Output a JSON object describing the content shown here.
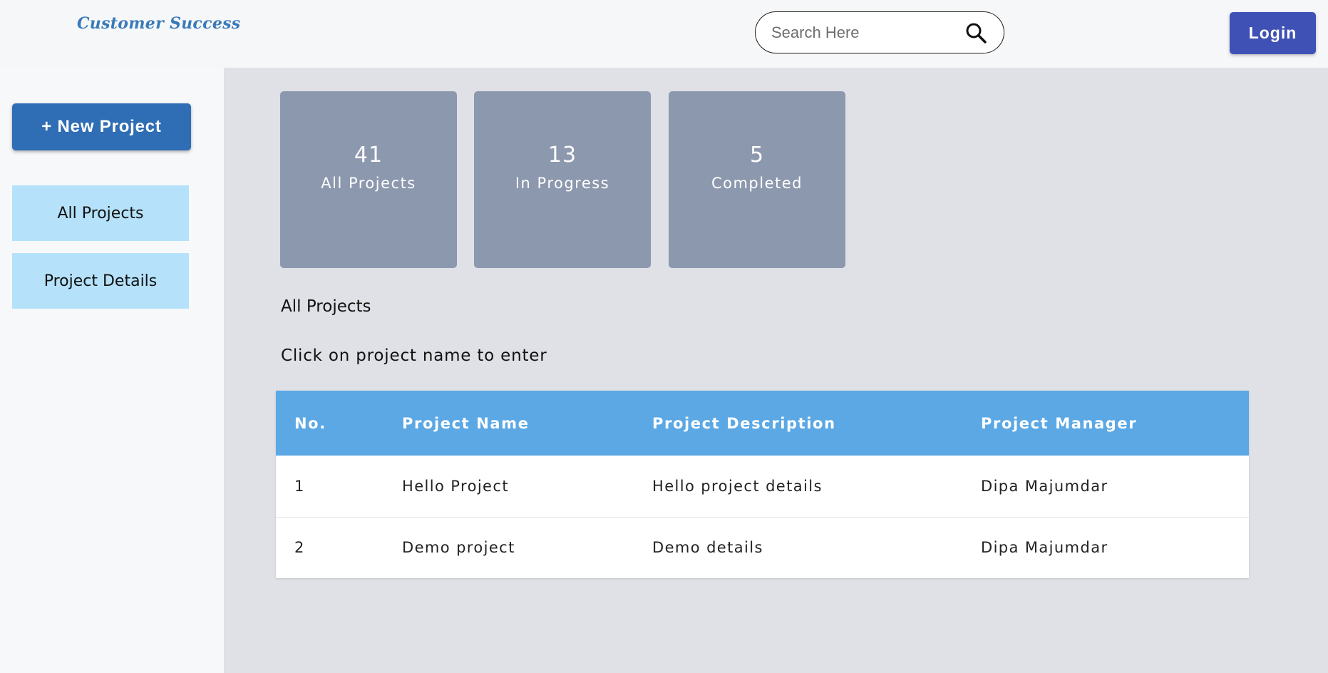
{
  "header": {
    "brand": "Customer Success",
    "search": {
      "placeholder": "Search Here",
      "value": ""
    },
    "login_label": "Login"
  },
  "sidebar": {
    "new_project_label": "+ New Project",
    "items": [
      {
        "label": "All Projects"
      },
      {
        "label": "Project Details"
      }
    ]
  },
  "stats": [
    {
      "value": "41",
      "label": "All Projects"
    },
    {
      "value": "13",
      "label": "In Progress"
    },
    {
      "value": "5",
      "label": "Completed"
    }
  ],
  "main": {
    "section_title": "All Projects",
    "hint": "Click on project name to enter"
  },
  "table": {
    "columns": [
      "No.",
      "Project Name",
      "Project Description",
      "Project Manager"
    ],
    "rows": [
      [
        "1",
        "Hello Project",
        "Hello project details",
        "Dipa Majumdar"
      ],
      [
        "2",
        "Demo project",
        "Demo details",
        "Dipa Majumdar"
      ]
    ]
  },
  "colors": {
    "brand": "#3a7ab8",
    "login_button": "#3f51b5",
    "new_project_button": "#2f6db5",
    "nav_item": "#b5e2fa",
    "stat_card": "#8c98ae",
    "table_header": "#5ba8e5",
    "main_background": "#dfe1e6"
  },
  "icons": {
    "search": "search-icon"
  }
}
